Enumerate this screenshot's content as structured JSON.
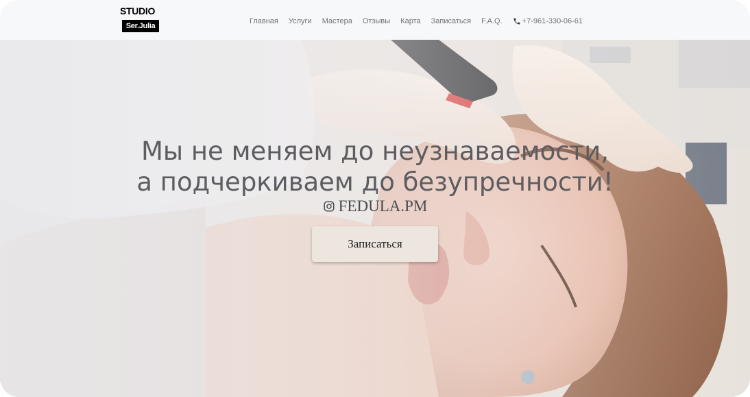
{
  "logo": {
    "line1": "STUDIO",
    "line2": "Ser.Julia"
  },
  "nav": {
    "items": [
      "Главная",
      "Услуги",
      "Мастера",
      "Отзывы",
      "Карта",
      "Записаться",
      "F.A.Q."
    ],
    "phone": "+7-961-330-06-61",
    "phone_icon": "phone-icon"
  },
  "hero": {
    "headline_line1": "Мы не меняем до неузнаваемости,",
    "headline_line2": "а подчеркиваем до безупречности!",
    "instagram_handle": "FEDULA.PM",
    "instagram_icon": "instagram-icon",
    "cta_label": "Записаться"
  },
  "colors": {
    "header_bg": "#f7f8fa",
    "nav_text": "#6f7378",
    "headline": "#5d5c60",
    "cta_bg": "#ece6de"
  }
}
